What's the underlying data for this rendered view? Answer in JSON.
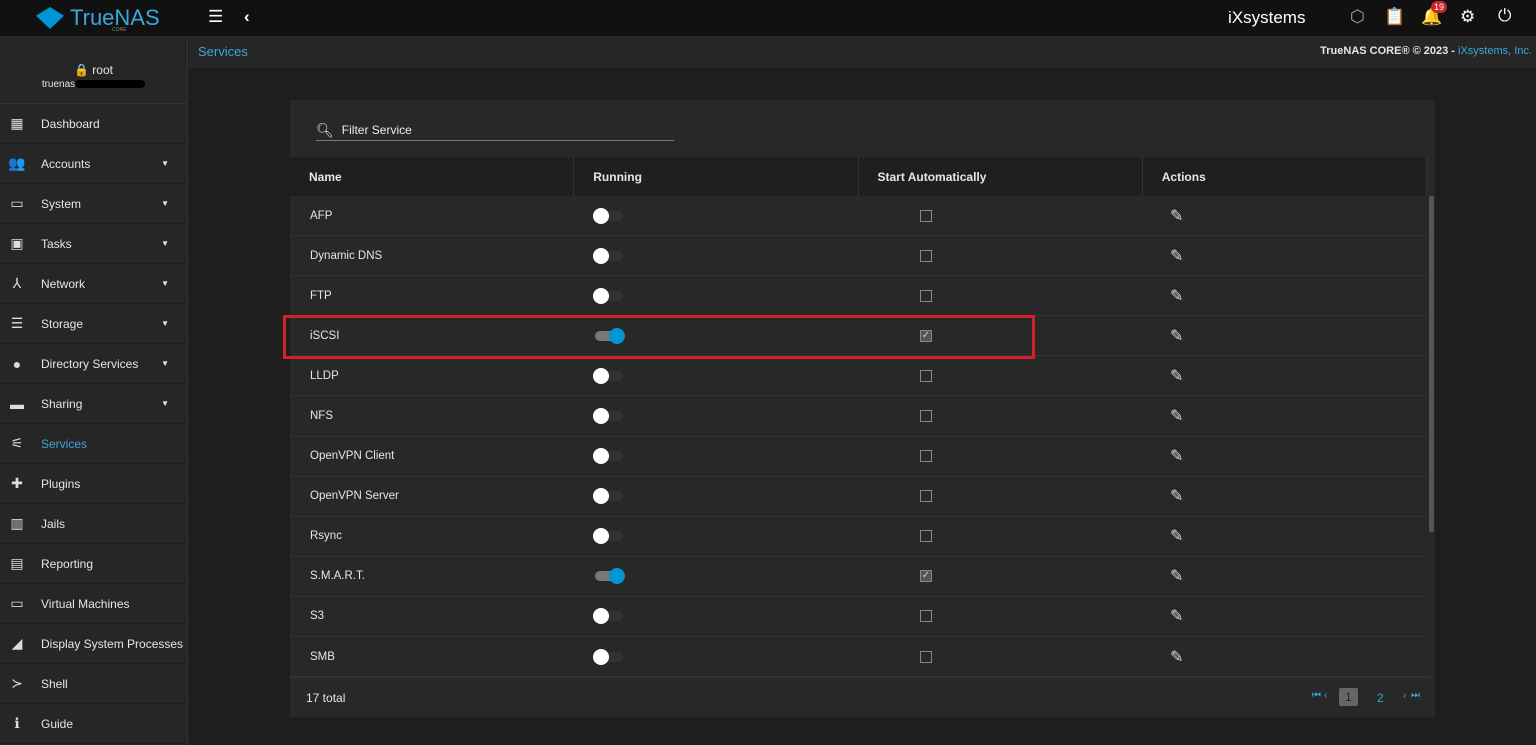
{
  "topbar": {
    "brand": "TrueNAS",
    "brand_sub": "CORE",
    "vendor": "iXsystems",
    "notifications": "19"
  },
  "user": {
    "name": "root",
    "host": "truenas"
  },
  "breadcrumb": "Services",
  "copyright": {
    "text": "TrueNAS CORE® © 2023 - ",
    "link": "iXsystems, Inc."
  },
  "sidebar": [
    {
      "label": "Dashboard",
      "icon": "▦",
      "sub": false
    },
    {
      "label": "Accounts",
      "icon": "👥",
      "sub": true
    },
    {
      "label": "System",
      "icon": "▭",
      "sub": true
    },
    {
      "label": "Tasks",
      "icon": "▣",
      "sub": true
    },
    {
      "label": "Network",
      "icon": "⅄",
      "sub": true
    },
    {
      "label": "Storage",
      "icon": "☰",
      "sub": true
    },
    {
      "label": "Directory Services",
      "icon": "●",
      "sub": true
    },
    {
      "label": "Sharing",
      "icon": "▬",
      "sub": true
    },
    {
      "label": "Services",
      "icon": "⚟",
      "sub": false,
      "active": true
    },
    {
      "label": "Plugins",
      "icon": "✚",
      "sub": false
    },
    {
      "label": "Jails",
      "icon": "▥",
      "sub": false
    },
    {
      "label": "Reporting",
      "icon": "▤",
      "sub": false
    },
    {
      "label": "Virtual Machines",
      "icon": "▭",
      "sub": false
    },
    {
      "label": "Display System Processes",
      "icon": "◢",
      "sub": false
    },
    {
      "label": "Shell",
      "icon": "≻",
      "sub": false
    },
    {
      "label": "Guide",
      "icon": "ℹ",
      "sub": false
    }
  ],
  "filter": {
    "placeholder": "Filter Service"
  },
  "columns": [
    "Name",
    "Running",
    "Start Automatically",
    "Actions"
  ],
  "services": [
    {
      "name": "AFP",
      "running": false,
      "auto": false
    },
    {
      "name": "Dynamic DNS",
      "running": false,
      "auto": false
    },
    {
      "name": "FTP",
      "running": false,
      "auto": false
    },
    {
      "name": "iSCSI",
      "running": true,
      "auto": true
    },
    {
      "name": "LLDP",
      "running": false,
      "auto": false
    },
    {
      "name": "NFS",
      "running": false,
      "auto": false
    },
    {
      "name": "OpenVPN Client",
      "running": false,
      "auto": false
    },
    {
      "name": "OpenVPN Server",
      "running": false,
      "auto": false
    },
    {
      "name": "Rsync",
      "running": false,
      "auto": false
    },
    {
      "name": "S.M.A.R.T.",
      "running": true,
      "auto": true
    },
    {
      "name": "S3",
      "running": false,
      "auto": false
    },
    {
      "name": "SMB",
      "running": false,
      "auto": false
    }
  ],
  "footer": {
    "total": "17 total",
    "pages": [
      "1",
      "2"
    ],
    "current_page": "1"
  }
}
